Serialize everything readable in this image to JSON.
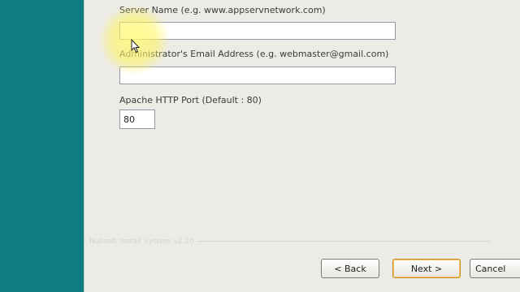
{
  "form": {
    "server_name_label": "Server Name (e.g. www.appservnetwork.com)",
    "server_name_value": "",
    "admin_email_label": "Administrator's Email Address (e.g. webmaster@gmail.com)",
    "admin_email_value": "",
    "http_port_label": "Apache HTTP Port (Default : 80)",
    "http_port_value": "80"
  },
  "footer": {
    "branding": "Nullsoft Install System v2.10"
  },
  "buttons": {
    "back": "< Back",
    "next": "Next >",
    "cancel": "Cancel"
  },
  "colors": {
    "desktop": "#0f7d84",
    "window": "#ecebe6",
    "cursor_highlight": "#fff35a"
  }
}
